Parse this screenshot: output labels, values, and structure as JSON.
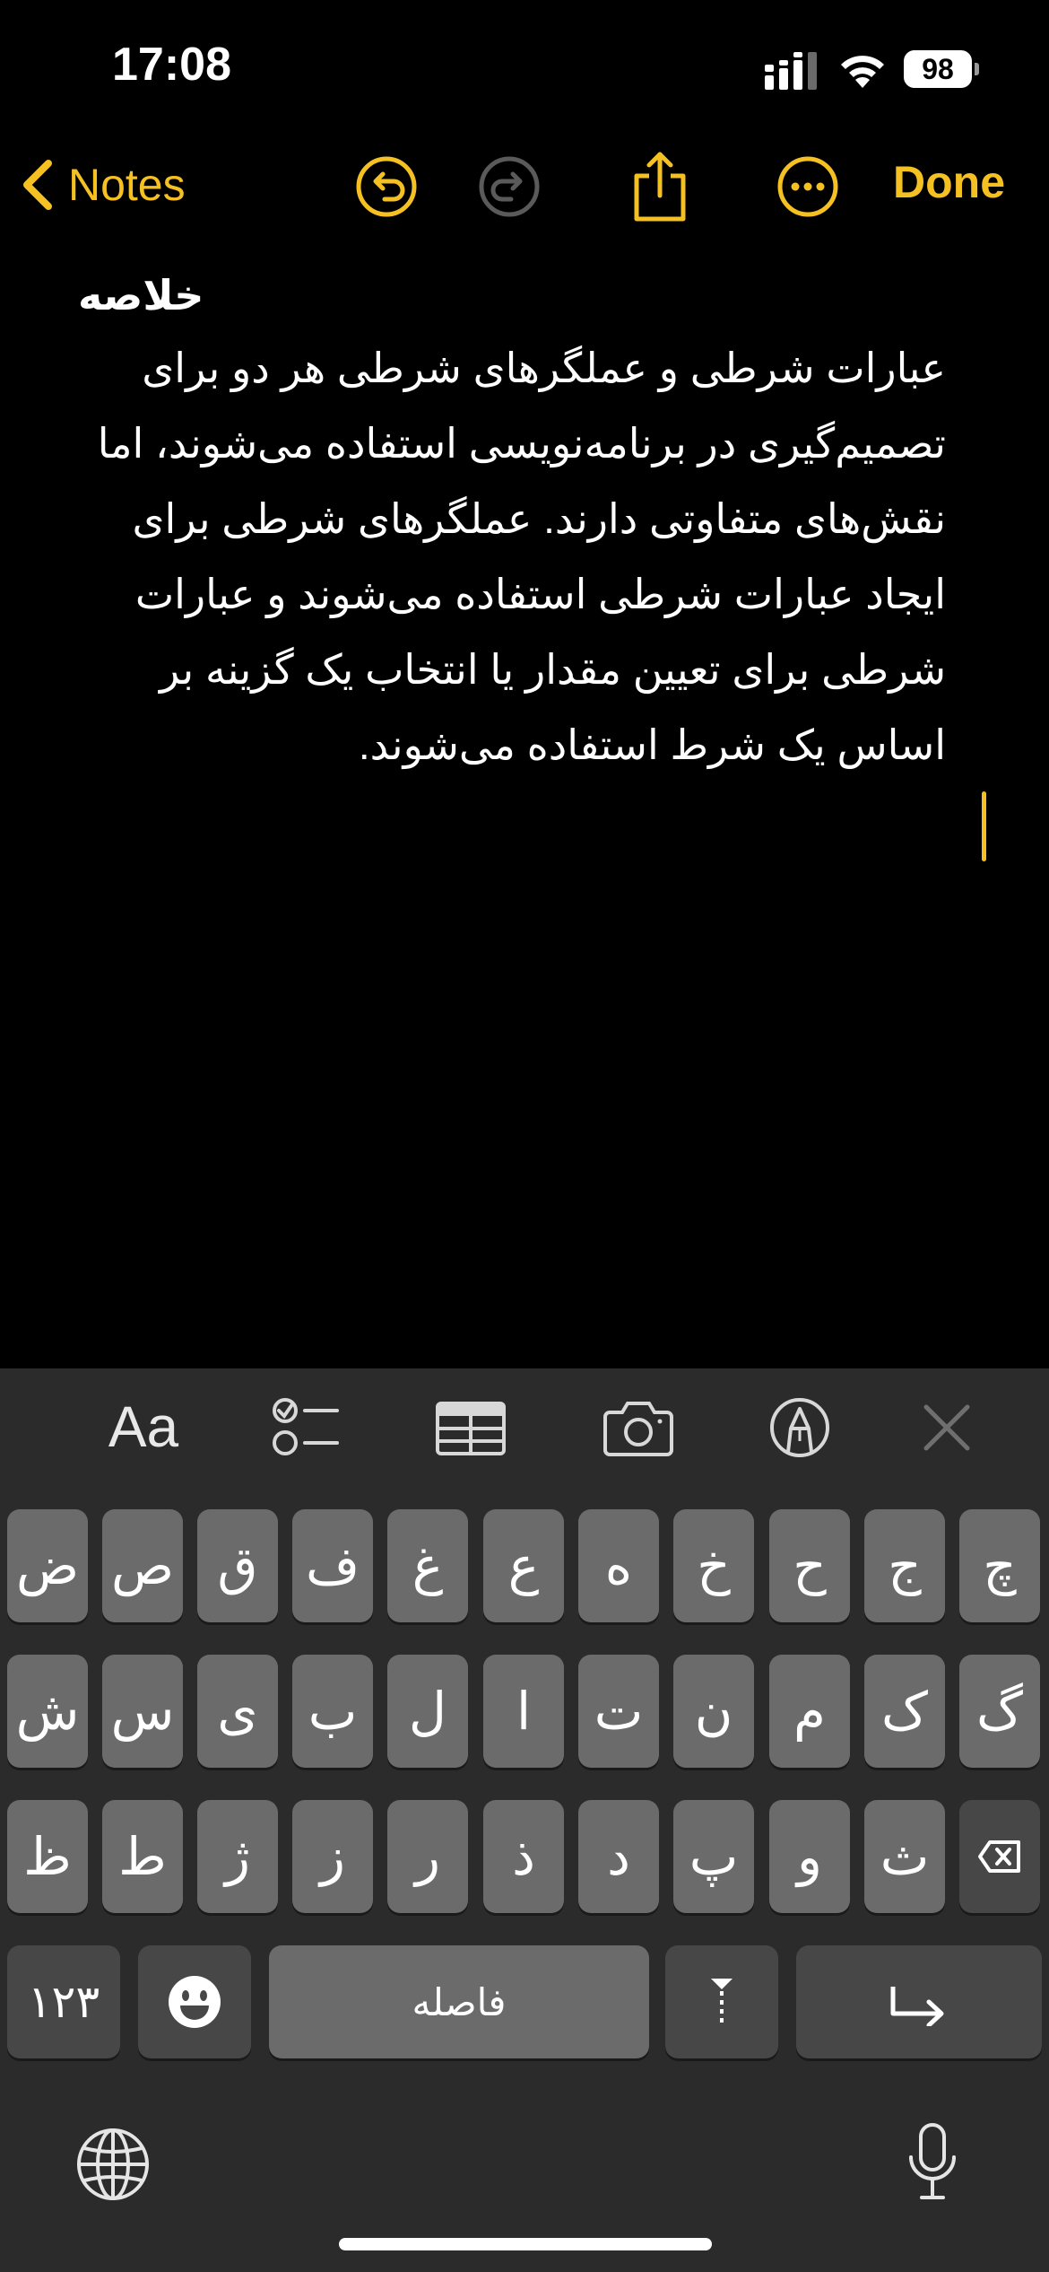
{
  "status_bar": {
    "time": "17:08",
    "battery": "98"
  },
  "nav": {
    "back_label": "Notes",
    "done_label": "Done"
  },
  "note": {
    "title": "خلاصه",
    "body_lines": [
      "عبارات شرطی و عملگرهای شرطی هر دو برای",
      "تصمیم‌گیری در برنامه‌نویسی استفاده می‌شوند، اما",
      "نقش‌های متفاوتی دارند. عملگرهای شرطی برای",
      "ایجاد عبارات شرطی استفاده می‌شوند و عبارات",
      "شرطی برای تعیین مقدار یا انتخاب یک گزینه بر",
      "اساس یک شرط استفاده می‌شوند."
    ]
  },
  "toolbar": {
    "format_label": "Aa"
  },
  "keyboard": {
    "row1": [
      "ض",
      "ص",
      "ق",
      "ف",
      "غ",
      "ع",
      "ه",
      "خ",
      "ح",
      "ج",
      "چ"
    ],
    "row2": [
      "ش",
      "س",
      "ی",
      "ب",
      "ل",
      "ا",
      "ت",
      "ن",
      "م",
      "ک",
      "گ"
    ],
    "row3": [
      "ظ",
      "ط",
      "ژ",
      "ز",
      "ر",
      "ذ",
      "د",
      "پ",
      "و",
      "ث"
    ],
    "numbers_label": "۱۲۳",
    "space_label": "فاصله"
  },
  "colors": {
    "accent": "#f5c122",
    "background": "#000000",
    "keyboard": "#2b2b2b",
    "key": "#6b6b6b"
  }
}
